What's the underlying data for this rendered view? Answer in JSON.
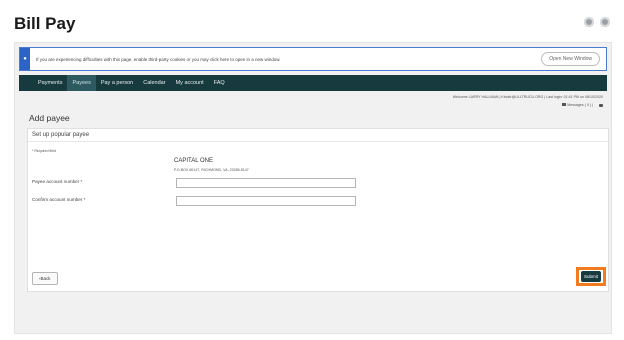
{
  "header": {
    "title": "Bill Pay"
  },
  "notice": {
    "text": "If you are experiencing difficulties with this page, enable third-party cookies or you may click here to open in a new window.",
    "button": "Open New Window"
  },
  "nav": {
    "items": [
      {
        "label": "Payments"
      },
      {
        "label": "Payees"
      },
      {
        "label": "Pay a person"
      },
      {
        "label": "Calendar"
      },
      {
        "label": "My account"
      },
      {
        "label": "FAQ"
      }
    ]
  },
  "session": {
    "welcome": "Welcome LARRY HALLMAN  |  Kbcktr@ULLTRUCU.ORG  |  Last login: 01:41 PM on 08/10/2020",
    "messages": "Messages ( 0 )  |"
  },
  "form": {
    "section_title": "Add payee",
    "card_title": "Set up popular payee",
    "required_note": "* Required field",
    "payee_name": "CAPITAL ONE",
    "payee_address": "P.O.BOX 60147, RICHMOND, VA, 23285-5147",
    "account_label": "Payee account number *",
    "confirm_label": "Confirm account number *",
    "account_value": "",
    "confirm_value": "",
    "back": "Back",
    "submit": "Submit"
  }
}
